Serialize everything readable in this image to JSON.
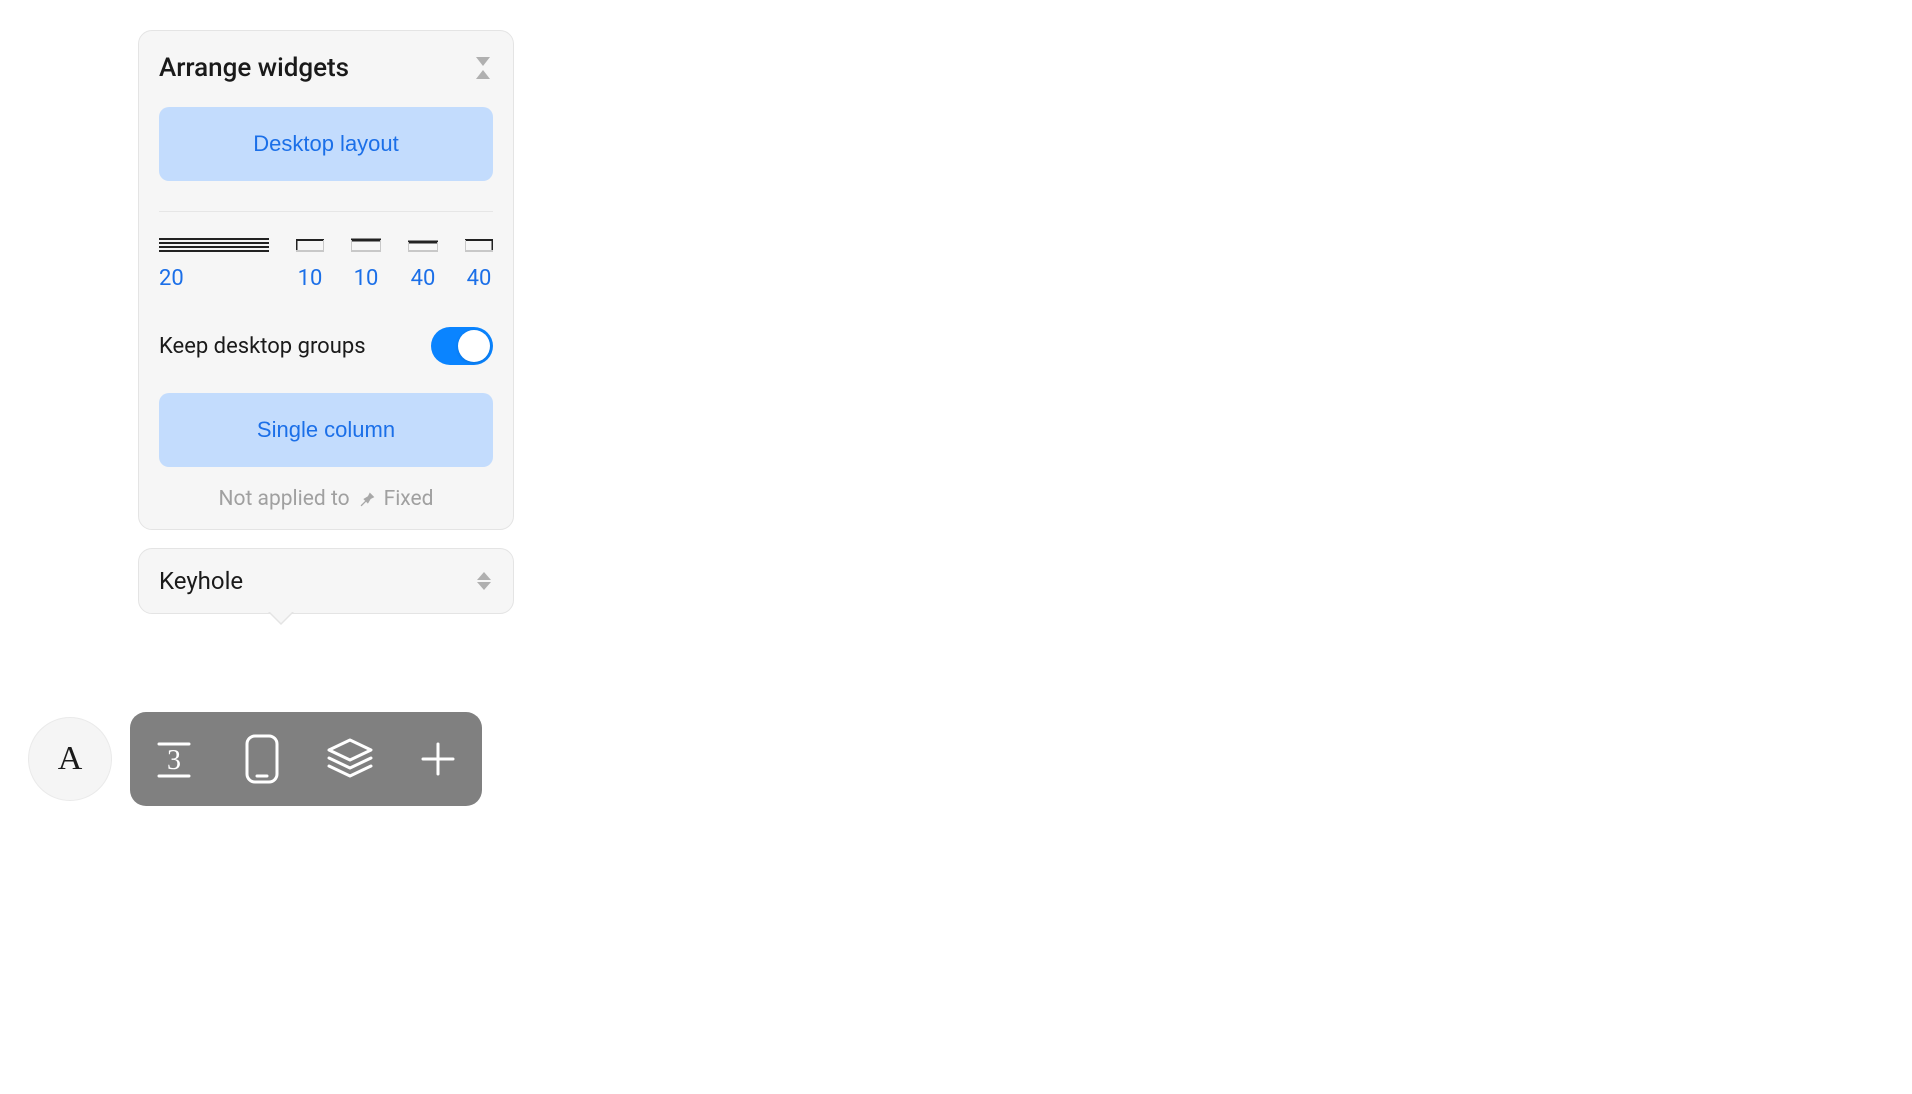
{
  "panel": {
    "title": "Arrange widgets",
    "desktop_layout_label": "Desktop layout",
    "thickness_values": [
      "20",
      "10",
      "10",
      "40",
      "40"
    ],
    "keep_groups_label": "Keep desktop groups",
    "keep_groups_on": true,
    "single_column_label": "Single column",
    "footer_prefix": "Not applied to",
    "footer_suffix": "Fixed"
  },
  "keyhole": {
    "label": "Keyhole"
  },
  "circle_button": {
    "label": "A"
  },
  "toolbar": {
    "number": "3"
  }
}
